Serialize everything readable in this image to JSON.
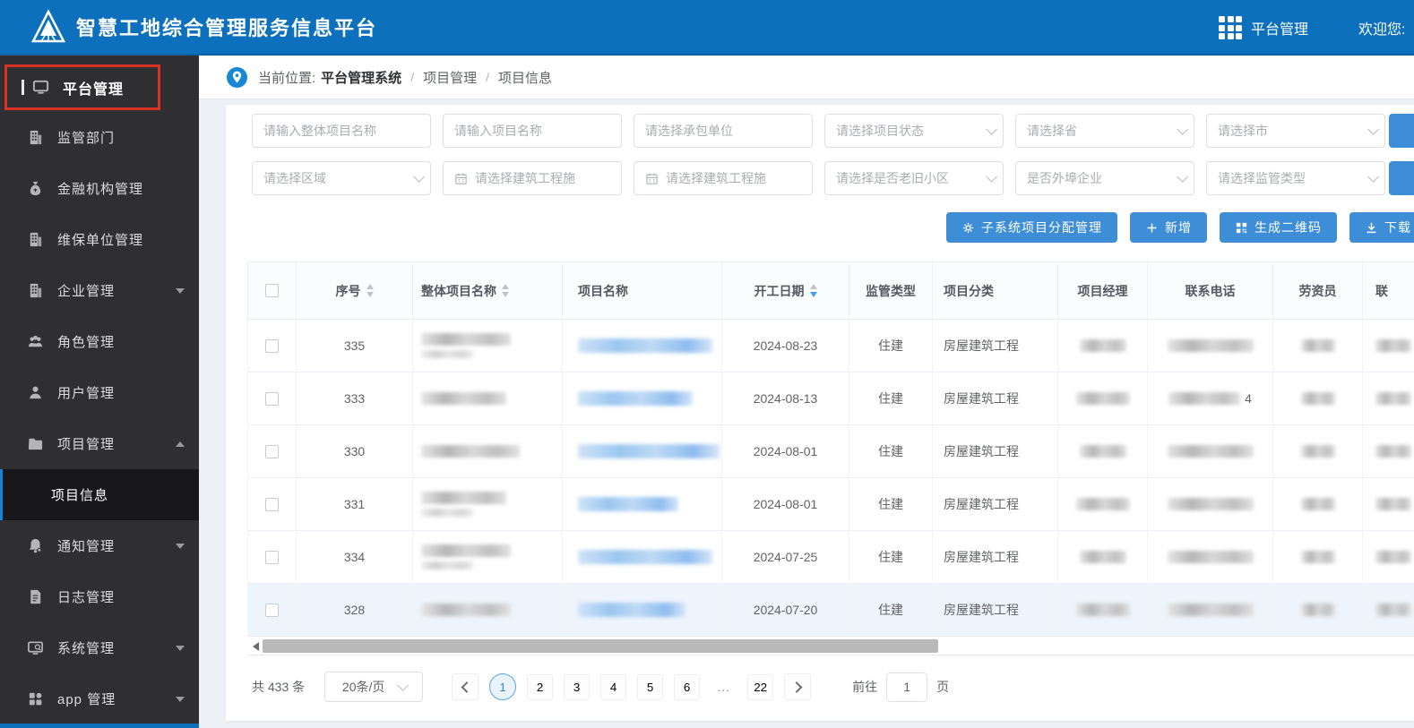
{
  "header": {
    "title": "智慧工地综合管理服务信息平台",
    "nav_label": "平台管理",
    "welcome": "欢迎您:"
  },
  "sidebar": {
    "items": [
      {
        "label": "平台管理",
        "icon": "monitor-icon",
        "highlighted": true
      },
      {
        "label": "监管部门",
        "icon": "building-icon"
      },
      {
        "label": "金融机构管理",
        "icon": "moneybag-icon"
      },
      {
        "label": "维保单位管理",
        "icon": "building-icon"
      },
      {
        "label": "企业管理",
        "icon": "building-icon",
        "arrow": "down"
      },
      {
        "label": "角色管理",
        "icon": "users-icon"
      },
      {
        "label": "用户管理",
        "icon": "user-icon"
      },
      {
        "label": "项目管理",
        "icon": "folder-icon",
        "arrow": "up"
      },
      {
        "label": "项目信息",
        "submenu": true,
        "active": true
      },
      {
        "label": "通知管理",
        "icon": "bell-icon",
        "arrow": "down"
      },
      {
        "label": "日志管理",
        "icon": "log-icon"
      },
      {
        "label": "系统管理",
        "icon": "system-icon",
        "arrow": "down"
      },
      {
        "label": "app 管理",
        "icon": "app-grid-icon",
        "arrow": "down"
      }
    ]
  },
  "breadcrumb": {
    "prefix": "当前位置:",
    "root": "平台管理系统",
    "separator": "/",
    "items": [
      "项目管理",
      "项目信息"
    ]
  },
  "filters": {
    "row1": [
      {
        "kind": "text",
        "placeholder": "请输入整体项目名称"
      },
      {
        "kind": "text",
        "placeholder": "请输入项目名称"
      },
      {
        "kind": "text",
        "placeholder": "请选择承包单位"
      },
      {
        "kind": "select",
        "placeholder": "请选择项目状态"
      },
      {
        "kind": "select",
        "placeholder": "请选择省"
      },
      {
        "kind": "select",
        "placeholder": "请选择市"
      }
    ],
    "row2": [
      {
        "kind": "select",
        "placeholder": "请选择区域"
      },
      {
        "kind": "date",
        "placeholder": "请选择建筑工程施"
      },
      {
        "kind": "date",
        "placeholder": "请选择建筑工程施"
      },
      {
        "kind": "select",
        "placeholder": "请选择是否老旧小区"
      },
      {
        "kind": "select",
        "placeholder": "是否外埠企业"
      },
      {
        "kind": "select",
        "placeholder": "请选择监管类型"
      }
    ]
  },
  "actions": [
    {
      "label": "子系统项目分配管理",
      "icon": "gear-icon"
    },
    {
      "label": "新增",
      "icon": "plus-icon"
    },
    {
      "label": "生成二维码",
      "icon": "qrcode-icon"
    },
    {
      "label": "下载",
      "icon": "download-icon"
    }
  ],
  "table": {
    "columns": [
      {
        "label": "",
        "kind": "checkbox"
      },
      {
        "label": "序号",
        "sortable": true
      },
      {
        "label": "整体项目名称",
        "sortable": true
      },
      {
        "label": "项目名称"
      },
      {
        "label": "开工日期",
        "sortable": true,
        "sort": "desc"
      },
      {
        "label": "监管类型"
      },
      {
        "label": "项目分类"
      },
      {
        "label": "项目经理"
      },
      {
        "label": "联系电话"
      },
      {
        "label": "劳资员"
      },
      {
        "label": "联"
      }
    ],
    "rows": [
      {
        "seq": "335",
        "start_date": "2024-08-23",
        "supervision": "住建",
        "category": "房屋建筑工程"
      },
      {
        "seq": "333",
        "start_date": "2024-08-13",
        "supervision": "住建",
        "category": "房屋建筑工程",
        "phone_visible": "4"
      },
      {
        "seq": "330",
        "start_date": "2024-08-01",
        "supervision": "住建",
        "category": "房屋建筑工程"
      },
      {
        "seq": "331",
        "start_date": "2024-08-01",
        "supervision": "住建",
        "category": "房屋建筑工程"
      },
      {
        "seq": "334",
        "start_date": "2024-07-25",
        "supervision": "住建",
        "category": "房屋建筑工程"
      },
      {
        "seq": "328",
        "start_date": "2024-07-20",
        "supervision": "住建",
        "category": "房屋建筑工程",
        "highlighted": true
      }
    ]
  },
  "pagination": {
    "total": "共 433 条",
    "page_size": "20条/页",
    "pages": [
      "1",
      "2",
      "3",
      "4",
      "5",
      "6",
      "...",
      "22"
    ],
    "active_page": "1",
    "goto_label": "前往",
    "goto_value": "1",
    "goto_unit": "页"
  },
  "colors": {
    "header_blue": "#0c70bd",
    "button_blue": "#3d8ed7",
    "active_page_blue": "#409eff",
    "highlight_red": "#d93126",
    "sidebar_dark": "#2f2f31"
  }
}
